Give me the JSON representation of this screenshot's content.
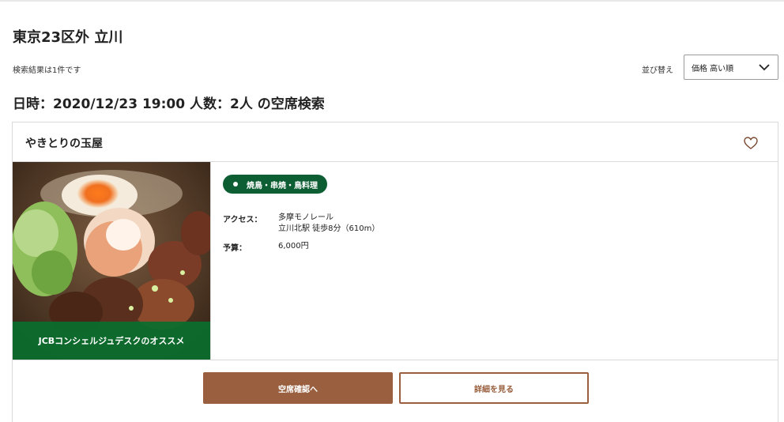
{
  "header": {
    "area_title": "東京23区外 立川",
    "result_count": "検索結果は1件です",
    "sort_label": "並び替え",
    "sort_selected": "価格 高い順",
    "search_conditions": "日時：2020/12/23 19:00 人数：2人 の空席検索"
  },
  "restaurant": {
    "name": "やきとりの玉屋",
    "favorite_icon": "heart-outline-icon",
    "photo_banner": "JCBコンシェルジュデスクのオススメ",
    "genre": "焼鳥・串焼・鳥料理",
    "access_label": "アクセス：",
    "access_line1": "多摩モノレール",
    "access_line2": "立川北駅 徒歩8分（610m）",
    "budget_label": "予算：",
    "budget_value": "6,000円"
  },
  "actions": {
    "check_availability": "空席確認へ",
    "view_details": "詳細を見る"
  },
  "colors": {
    "brand_brown": "#995f3e",
    "genre_green": "#0d5e33",
    "banner_green": "#0a6e2d"
  }
}
